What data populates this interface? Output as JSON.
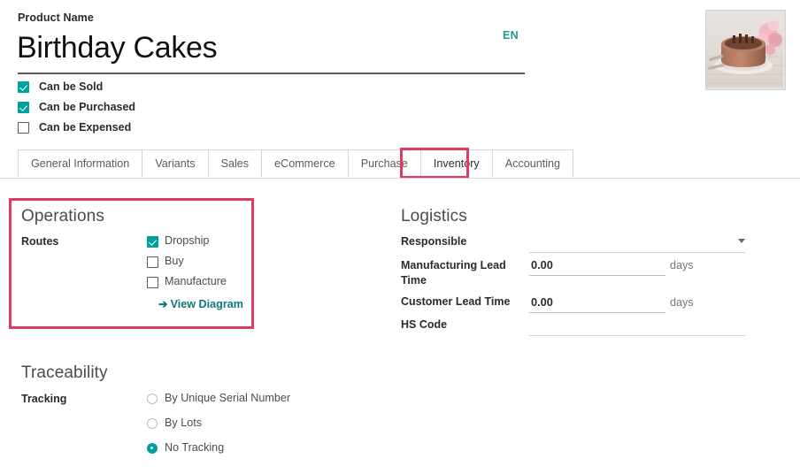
{
  "header": {
    "product_name_label": "Product Name",
    "product_name_value": "Birthday Cakes",
    "language_badge": "EN",
    "image_alt": "birthday-cake-photo",
    "flags": [
      {
        "label": "Can be Sold",
        "checked": true
      },
      {
        "label": "Can be Purchased",
        "checked": true
      },
      {
        "label": "Can be Expensed",
        "checked": false
      }
    ]
  },
  "tabs": [
    {
      "label": "General Information",
      "active": false
    },
    {
      "label": "Variants",
      "active": false
    },
    {
      "label": "Sales",
      "active": false
    },
    {
      "label": "eCommerce",
      "active": false
    },
    {
      "label": "Purchase",
      "active": false
    },
    {
      "label": "Inventory",
      "active": true
    },
    {
      "label": "Accounting",
      "active": false
    }
  ],
  "operations": {
    "title": "Operations",
    "routes_label": "Routes",
    "routes": [
      {
        "label": "Dropship",
        "checked": true
      },
      {
        "label": "Buy",
        "checked": false
      },
      {
        "label": "Manufacture",
        "checked": false
      }
    ],
    "view_diagram_arrow": "➔",
    "view_diagram_label": "View Diagram"
  },
  "logistics": {
    "title": "Logistics",
    "responsible_label": "Responsible",
    "responsible_value": "",
    "manufacturing_lead_time_label": "Manufacturing Lead Time",
    "manufacturing_lead_time_value": "0.00",
    "manufacturing_lead_time_unit": "days",
    "customer_lead_time_label": "Customer Lead Time",
    "customer_lead_time_value": "0.00",
    "customer_lead_time_unit": "days",
    "hs_code_label": "HS Code",
    "hs_code_value": ""
  },
  "traceability": {
    "title": "Traceability",
    "tracking_label": "Tracking",
    "options": [
      {
        "label": "By Unique Serial Number",
        "selected": false
      },
      {
        "label": "By Lots",
        "selected": false
      },
      {
        "label": "No Tracking",
        "selected": true
      }
    ]
  },
  "colors": {
    "accent_teal": "#00a09d",
    "link_teal": "#087b78",
    "highlight_red": "#e03a63",
    "text_dark": "#2b2b2b",
    "text_muted": "#767676",
    "border_grey": "#d6d6d6"
  }
}
